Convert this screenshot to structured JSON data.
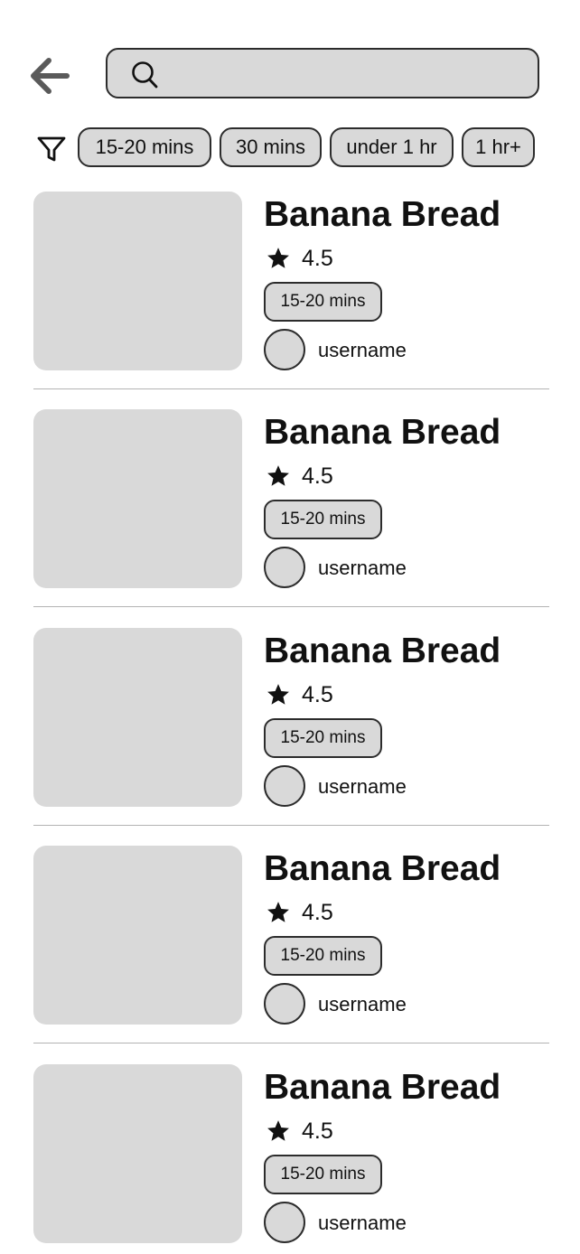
{
  "header": {
    "back_icon": "arrow-left-icon",
    "search": {
      "icon": "search-icon",
      "value": "",
      "placeholder": ""
    }
  },
  "filters": {
    "icon": "filter-icon",
    "chips": [
      "15-20 mins",
      "30 mins",
      "under 1 hr",
      "1 hr+"
    ]
  },
  "recipes": [
    {
      "title": "Banana Bread",
      "rating": "4.5",
      "time": "15-20 mins",
      "username": "username"
    },
    {
      "title": "Banana Bread",
      "rating": "4.5",
      "time": "15-20 mins",
      "username": "username"
    },
    {
      "title": "Banana Bread",
      "rating": "4.5",
      "time": "15-20 mins",
      "username": "username"
    },
    {
      "title": "Banana Bread",
      "rating": "4.5",
      "time": "15-20 mins",
      "username": "username"
    },
    {
      "title": "Banana Bread",
      "rating": "4.5",
      "time": "15-20 mins",
      "username": "username"
    }
  ],
  "colors": {
    "placeholder_gray": "#d9d9d9",
    "outline": "#2c2c2c",
    "divider": "#b3b3b3",
    "text": "#111111",
    "back_arrow": "#5a5a5a"
  }
}
